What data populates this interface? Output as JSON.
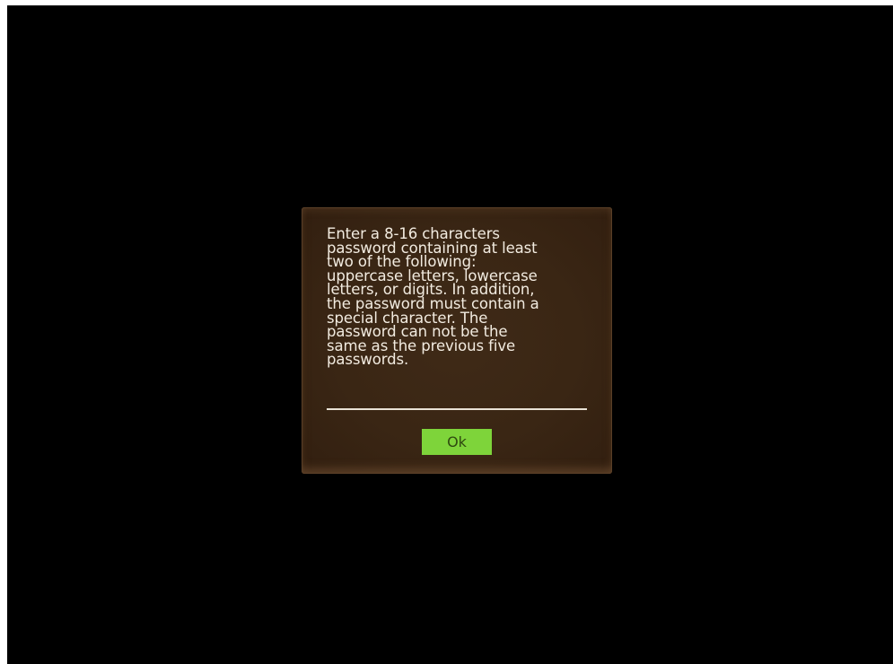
{
  "dialog": {
    "message": "Enter a 8-16 characters\npassword containing at least\ntwo of the following:\nuppercase letters, lowercase\nletters, or digits. In addition,\nthe password must contain a\nspecial character. The\npassword can not be the\nsame as the previous five\npasswords.",
    "ok_label": "Ok"
  },
  "colors": {
    "screen_background": "#000000",
    "dialog_background": "#3a2614",
    "text": "#f2ebe0",
    "ok_button": "#7ed43a",
    "ok_button_text": "#2f4a10"
  }
}
